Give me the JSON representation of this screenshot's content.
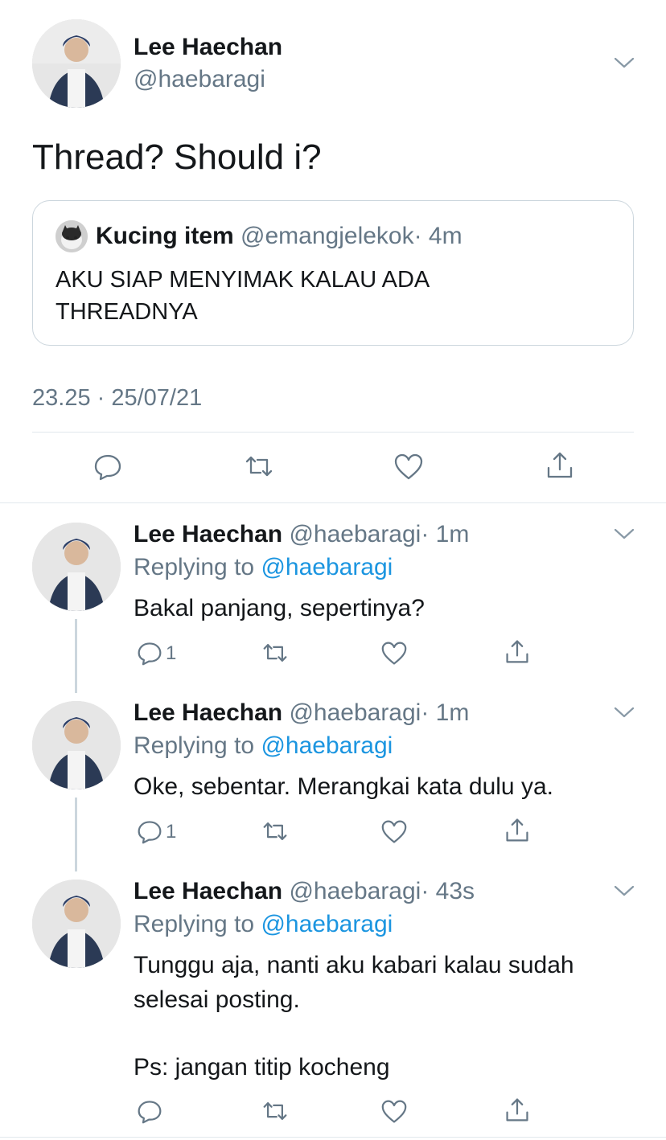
{
  "main_tweet": {
    "name": "Lee Haechan",
    "handle": "@haebaragi",
    "text": "Thread? Should i?",
    "timestamp": "23.25 · 25/07/21",
    "quoted": {
      "name": "Kucing item",
      "handle": "@emangjelekok",
      "time": "· 4m",
      "text_line1": "AKU SIAP MENYIMAK KALAU ADA",
      "text_line2": "THREADNYA"
    }
  },
  "replies": [
    {
      "name": "Lee Haechan",
      "handle": "@haebaragi",
      "time": "· 1m",
      "replying_prefix": "Replying to",
      "replying_to": "@haebaragi",
      "text_line1": "Bakal panjang, sepertinya?",
      "reply_count": "1"
    },
    {
      "name": "Lee Haechan",
      "handle": "@haebaragi",
      "time": "· 1m",
      "replying_prefix": "Replying to",
      "replying_to": "@haebaragi",
      "text_line1": "Oke, sebentar. Merangkai kata dulu ya.",
      "reply_count": "1"
    },
    {
      "name": "Lee Haechan",
      "handle": "@haebaragi",
      "time": "· 43s",
      "replying_prefix": "Replying to",
      "replying_to": "@haebaragi",
      "text_line1": "Tunggu aja, nanti aku kabari kalau sudah",
      "text_line2": "selesai posting.",
      "text_line3": "Ps: jangan titip kocheng",
      "reply_count": ""
    }
  ],
  "colors": {
    "text": "#14171a",
    "muted": "#657786",
    "link": "#1b95e0",
    "divider": "#e1e8ed",
    "thread_line": "#ccd6dd"
  },
  "icons": [
    "chevron-down-icon",
    "reply-icon",
    "retweet-icon",
    "like-icon",
    "share-icon"
  ]
}
